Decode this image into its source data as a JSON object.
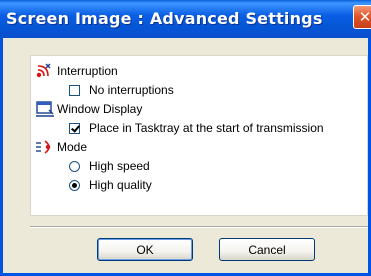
{
  "window": {
    "title": "Screen Image : Advanced Settings",
    "close_glyph": "✕"
  },
  "sections": {
    "interruption": {
      "label": "Interruption",
      "icon": "interruption-icon",
      "options": [
        {
          "type": "checkbox",
          "label": "No interruptions",
          "checked": false
        }
      ]
    },
    "window_display": {
      "label": "Window Display",
      "icon": "window-display-icon",
      "options": [
        {
          "type": "checkbox",
          "label": "Place in Tasktray at the start of transmission",
          "checked": true
        }
      ]
    },
    "mode": {
      "label": "Mode",
      "icon": "mode-icon",
      "options": [
        {
          "type": "radio",
          "label": "High speed",
          "checked": false
        },
        {
          "type": "radio",
          "label": "High quality",
          "checked": true
        }
      ]
    }
  },
  "buttons": {
    "ok": "OK",
    "cancel": "Cancel"
  },
  "colors": {
    "titlebar": "#0b5fe5",
    "dialog_bg": "#ece9d8",
    "close_btn": "#e2572b"
  }
}
